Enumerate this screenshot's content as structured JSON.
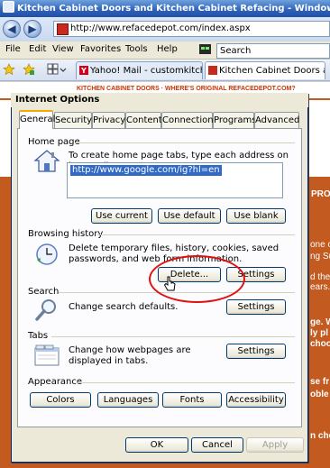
{
  "browser": {
    "window_title": "Kitchen Cabinet Doors and Kitchen Cabinet Refacing - Windows Internet Explorer",
    "address": "http://www.refacedepot.com/index.aspx",
    "menu": [
      "File",
      "Edit",
      "View",
      "Favorites",
      "Tools",
      "Help"
    ],
    "search_placeholder": "Search",
    "tabs": [
      {
        "label": "Yahoo! Mail - customkitchenc..."
      },
      {
        "label": "Kitchen Cabinet Doors an..."
      }
    ]
  },
  "webpage": {
    "fragments": {
      "top_links": "KITCHEN CABINET DOORS   ·   WHERE'S ORIGINAL REFACEDEPOT.COM?",
      "pro": "PRO",
      "r1": "one o",
      "r2": "ng Su",
      "r3": "d the",
      "r4": "ears.",
      "r5": "ge. W",
      "r6": "ly pl",
      "r7": "choo",
      "r8": "se fr",
      "r9": "oble a",
      "r10": "n cho"
    },
    "colors": {
      "orange": "#c35a1f",
      "link": "#cc3300"
    }
  },
  "dialog": {
    "title": "Internet Options",
    "tabs": [
      "General",
      "Security",
      "Privacy",
      "Content",
      "Connections",
      "Programs",
      "Advanced"
    ],
    "active_tab": "General",
    "home_page": {
      "label": "Home page",
      "description": "To create home page tabs, type each address on its own line.",
      "value": "http://www.google.com/ig?hl=en",
      "buttons": [
        "Use current",
        "Use default",
        "Use blank"
      ]
    },
    "browsing_history": {
      "label": "Browsing history",
      "description": "Delete temporary files, history, cookies, saved passwords, and web form information.",
      "delete_button": "Delete...",
      "settings_button": "Settings"
    },
    "search": {
      "label": "Search",
      "description": "Change search defaults.",
      "settings_button": "Settings"
    },
    "tabs_section": {
      "label": "Tabs",
      "description": "Change how webpages are displayed in tabs.",
      "settings_button": "Settings"
    },
    "appearance": {
      "label": "Appearance",
      "buttons": [
        "Colors",
        "Languages",
        "Fonts",
        "Accessibility"
      ]
    },
    "footer": {
      "ok": "OK",
      "cancel": "Cancel",
      "apply": "Apply"
    },
    "highlight_color": "#e21010"
  }
}
